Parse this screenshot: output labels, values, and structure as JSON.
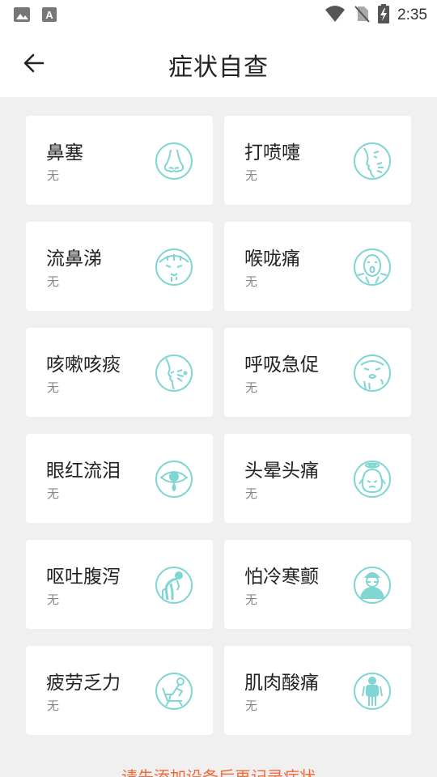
{
  "status_bar": {
    "time": "2:35",
    "left_icons": [
      "image-icon",
      "a-box-icon"
    ],
    "right_icons": [
      "wifi-icon",
      "no-sim-icon",
      "battery-charging-icon"
    ]
  },
  "header": {
    "title": "症状自查",
    "back_icon": "arrow-left-icon"
  },
  "symptoms": [
    {
      "name": "鼻塞",
      "status": "无",
      "icon": "nose-icon"
    },
    {
      "name": "打喷嚏",
      "status": "无",
      "icon": "sneeze-icon"
    },
    {
      "name": "流鼻涕",
      "status": "无",
      "icon": "runny-nose-icon"
    },
    {
      "name": "喉咙痛",
      "status": "无",
      "icon": "sore-throat-icon"
    },
    {
      "name": "咳嗽咳痰",
      "status": "无",
      "icon": "cough-icon"
    },
    {
      "name": "呼吸急促",
      "status": "无",
      "icon": "shortness-of-breath-icon"
    },
    {
      "name": "眼红流泪",
      "status": "无",
      "icon": "eye-tear-icon"
    },
    {
      "name": "头晕头痛",
      "status": "无",
      "icon": "headache-icon"
    },
    {
      "name": "呕吐腹泻",
      "status": "无",
      "icon": "vomit-icon"
    },
    {
      "name": "怕冷寒颤",
      "status": "无",
      "icon": "chills-icon"
    },
    {
      "name": "疲劳乏力",
      "status": "无",
      "icon": "fatigue-icon"
    },
    {
      "name": "肌肉酸痛",
      "status": "无",
      "icon": "muscle-ache-icon"
    }
  ],
  "footer_note": "请先添加设备后再记录症状",
  "colors": {
    "icon": "#7fd6d2",
    "footer_text": "#f26b3a",
    "background": "#f0f0f0",
    "card": "#ffffff"
  }
}
